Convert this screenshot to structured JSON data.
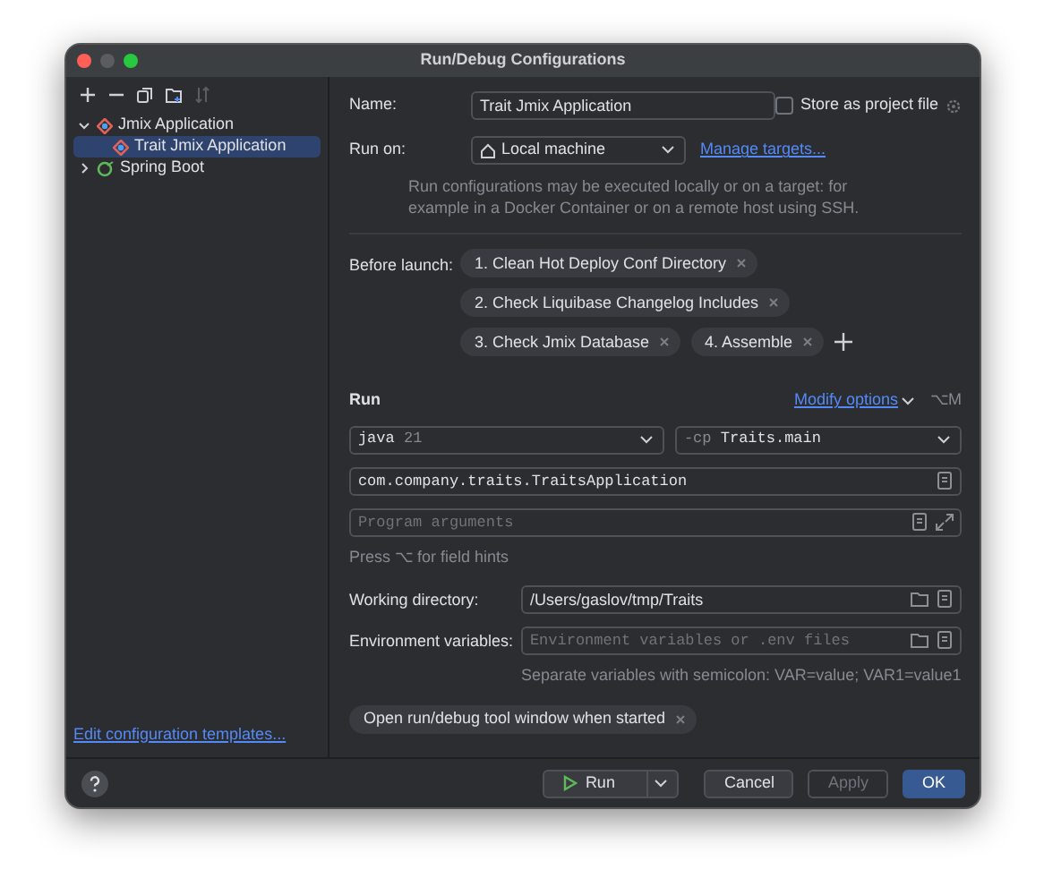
{
  "window": {
    "title": "Run/Debug Configurations"
  },
  "tree": [
    {
      "label": "Jmix Application",
      "expanded": true,
      "selected": false,
      "children": [
        {
          "label": "Trait Jmix Application",
          "selected": true
        }
      ]
    },
    {
      "label": "Spring Boot",
      "expanded": false,
      "selected": false
    }
  ],
  "edit_templates_link": "Edit configuration templates...",
  "name": {
    "label": "Name:",
    "value": "Trait Jmix Application"
  },
  "store_as_project_file": {
    "label": "Store as project file",
    "checked": false
  },
  "run_on": {
    "label": "Run on:",
    "value": "Local machine",
    "link": "Manage targets...",
    "help": "Run configurations may be executed locally or on a target: for example in a Docker Container or on a remote host using SSH."
  },
  "before_launch": {
    "label": "Before launch:",
    "tasks": [
      "1. Clean Hot Deploy Conf Directory",
      "2. Check Liquibase Changelog Includes",
      "3. Check Jmix Database",
      "4. Assemble"
    ]
  },
  "run_section": {
    "title": "Run",
    "modify_options": "Modify options",
    "shortcut": "⌥M",
    "jdk": {
      "value": "java",
      "version": "21"
    },
    "classpath": {
      "prefix": "-cp",
      "value": "Traits.main"
    },
    "main_class": "com.company.traits.TraitsApplication",
    "program_arguments": {
      "placeholder": "Program arguments"
    },
    "hint": "Press ⌥ for field hints"
  },
  "working_directory": {
    "label": "Working directory:",
    "value": "/Users/gaslov/tmp/Traits"
  },
  "environment_variables": {
    "label": "Environment variables:",
    "placeholder": "Environment variables or .env files",
    "hint": "Separate variables with semicolon: VAR=value; VAR1=value1"
  },
  "options": [
    "Open run/debug tool window when started"
  ],
  "buttons": [
    {
      "label": "Run",
      "kind": "split",
      "disabled": false,
      "primary": false
    },
    {
      "label": "Cancel",
      "kind": "plain",
      "disabled": false,
      "primary": false
    },
    {
      "label": "Apply",
      "kind": "plain",
      "disabled": true,
      "primary": false
    },
    {
      "label": "OK",
      "kind": "plain",
      "disabled": false,
      "primary": true
    }
  ]
}
